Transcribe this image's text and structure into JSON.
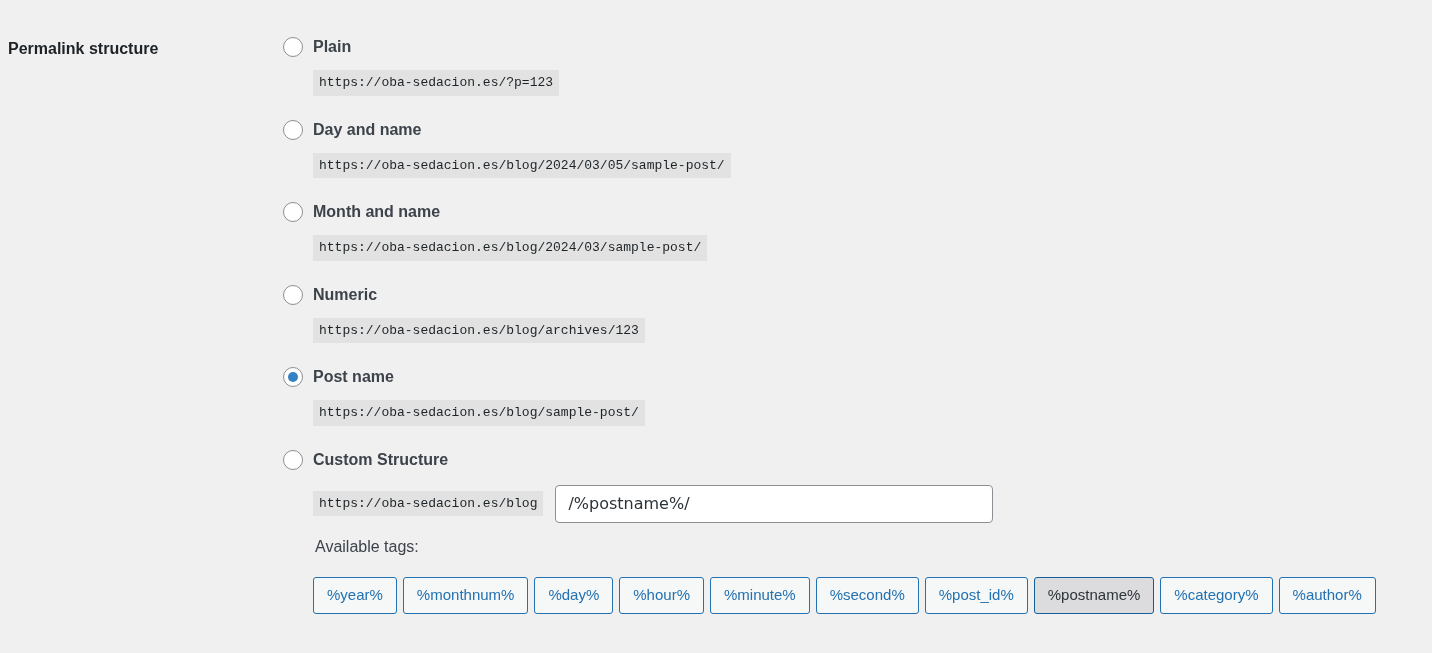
{
  "section_label": "Permalink structure",
  "options": [
    {
      "label": "Plain",
      "example": "https://oba-sedacion.es/?p=123",
      "selected": false
    },
    {
      "label": "Day and name",
      "example": "https://oba-sedacion.es/blog/2024/03/05/sample-post/",
      "selected": false
    },
    {
      "label": "Month and name",
      "example": "https://oba-sedacion.es/blog/2024/03/sample-post/",
      "selected": false
    },
    {
      "label": "Numeric",
      "example": "https://oba-sedacion.es/blog/archives/123",
      "selected": false
    },
    {
      "label": "Post name",
      "example": "https://oba-sedacion.es/blog/sample-post/",
      "selected": true
    },
    {
      "label": "Custom Structure",
      "example": "https://oba-sedacion.es/blog",
      "selected": false
    }
  ],
  "custom_structure": {
    "value": "/%postname%/"
  },
  "available_tags_label": "Available tags:",
  "tags": [
    {
      "label": "%year%",
      "selected": false
    },
    {
      "label": "%monthnum%",
      "selected": false
    },
    {
      "label": "%day%",
      "selected": false
    },
    {
      "label": "%hour%",
      "selected": false
    },
    {
      "label": "%minute%",
      "selected": false
    },
    {
      "label": "%second%",
      "selected": false
    },
    {
      "label": "%post_id%",
      "selected": false
    },
    {
      "label": "%postname%",
      "selected": true
    },
    {
      "label": "%category%",
      "selected": false
    },
    {
      "label": "%author%",
      "selected": false
    }
  ]
}
